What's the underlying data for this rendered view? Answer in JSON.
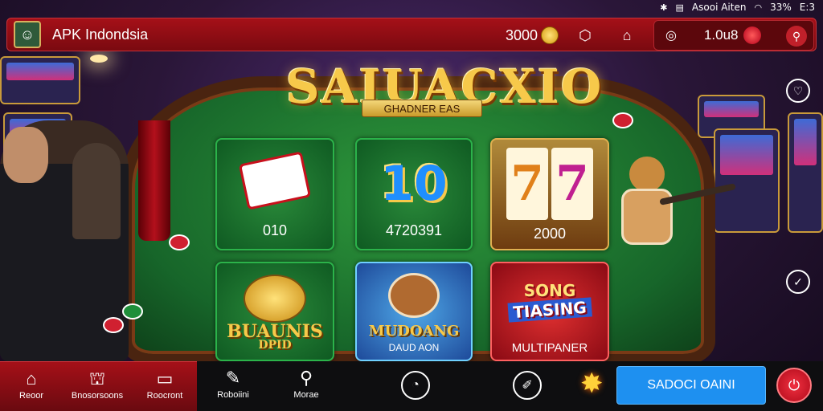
{
  "status_bar": {
    "label": "Asooi Aiten",
    "battery": "33%",
    "time": "E:3"
  },
  "topbar": {
    "app_title": "APK Indondsia",
    "coins": "3000",
    "balance": "1.0u8"
  },
  "hero": {
    "logo_text": "SAIUACXIO",
    "logo_sub": "GHADNER EAS"
  },
  "games": [
    {
      "name": "card-a",
      "label": "010"
    },
    {
      "name": "card-b",
      "art": "10",
      "label": "4720391"
    },
    {
      "name": "card-c",
      "reels": [
        "7",
        "7"
      ],
      "label": "2000"
    },
    {
      "name": "card-d",
      "art_line1": "BUAUNIS",
      "art_line2": "DPID"
    },
    {
      "name": "card-e",
      "art_line1": "MUDOANG",
      "art_line2": "DAUD AON"
    },
    {
      "name": "card-f",
      "art_line1": "SONG",
      "art_line2": "TIASING",
      "label": "MULTIPANER"
    }
  ],
  "bottom_nav": {
    "items": [
      {
        "label": "Reoor",
        "icon": "home-icon"
      },
      {
        "label": "Bnosorsoons",
        "icon": "shop-icon"
      },
      {
        "label": "Roocront",
        "icon": "message-icon"
      },
      {
        "label": "Roboiini",
        "icon": "document-icon"
      },
      {
        "label": "Morae",
        "icon": "search-icon"
      }
    ],
    "cta_label": "SADOCI OAINI"
  },
  "colors": {
    "accent_red": "#a51018",
    "cta_blue": "#1e90f0",
    "table_green": "#17662a",
    "gold": "#f7c94a"
  }
}
